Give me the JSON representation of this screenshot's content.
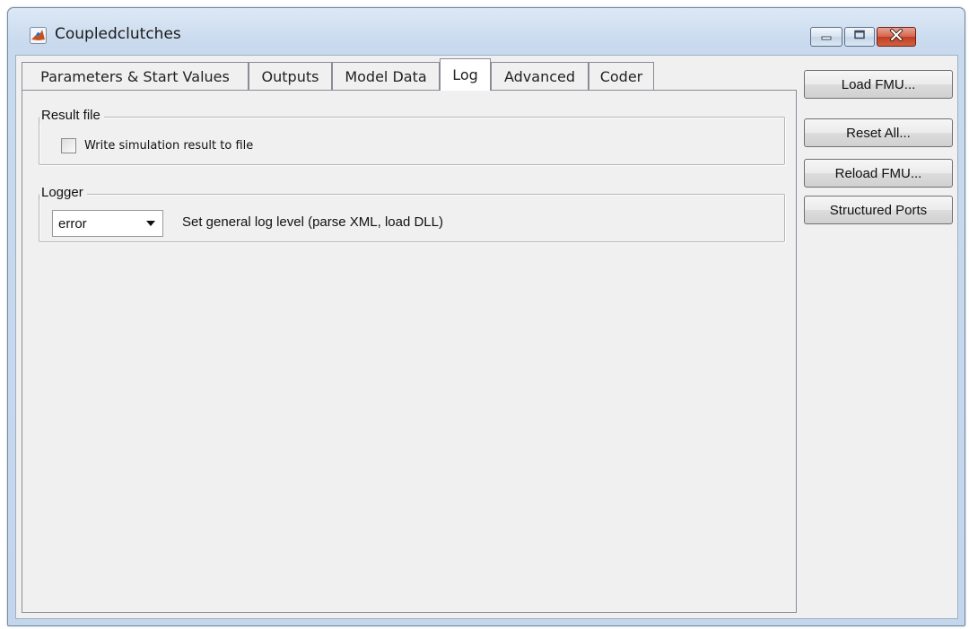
{
  "window": {
    "title": "Coupledclutches",
    "icons": {
      "app": "matlab-logo-icon",
      "minimize": "minimize-icon",
      "maximize": "maximize-icon",
      "close": "close-icon"
    },
    "colors": {
      "close_button": "#c94a2f",
      "frame": "#c9daee"
    }
  },
  "tabs": [
    {
      "label": "Parameters & Start Values",
      "active": false
    },
    {
      "label": "Outputs",
      "active": false
    },
    {
      "label": "Model Data",
      "active": false
    },
    {
      "label": "Log",
      "active": true
    },
    {
      "label": "Advanced",
      "active": false
    },
    {
      "label": "Coder",
      "active": false
    }
  ],
  "result_file": {
    "legend": "Result file",
    "checkbox_label": "Write simulation result to file",
    "checked": false
  },
  "logger": {
    "legend": "Logger",
    "level_value": "error",
    "description": "Set general log level (parse XML, load DLL)"
  },
  "side_buttons": {
    "load_fmu": "Load FMU...",
    "reset_all": "Reset All...",
    "reload_fmu": "Reload FMU...",
    "structured_ports": "Structured Ports"
  }
}
